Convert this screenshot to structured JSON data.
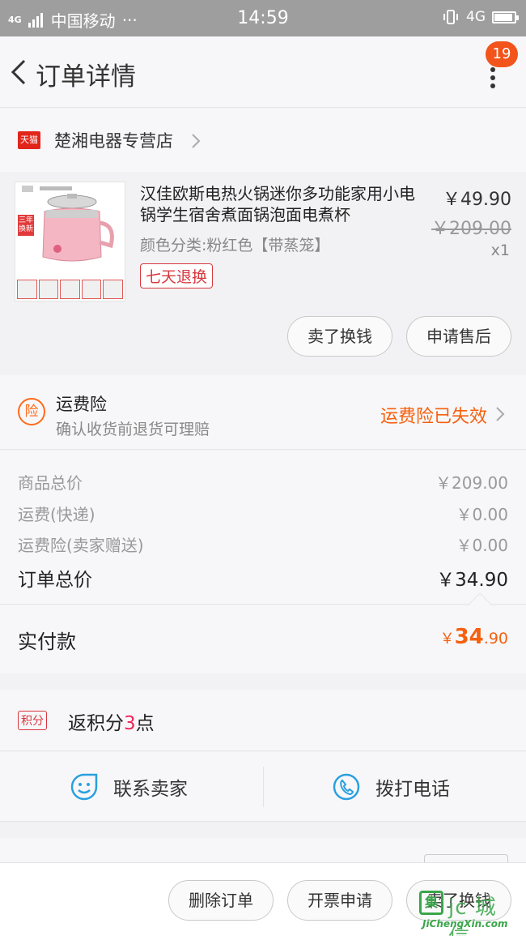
{
  "status_bar": {
    "network_tag": "4G",
    "carrier": "中国移动",
    "more": "···",
    "time": "14:59",
    "network_right": "4G",
    "battery_level": 0.9
  },
  "header": {
    "title": "订单详情",
    "badge_count": "19"
  },
  "store": {
    "tmall_tag": "天猫",
    "name": "楚湘电器专营店"
  },
  "product": {
    "title": "汉佳欧斯电热火锅迷你多功能家用小电锅学生宿舍煮面锅泡面电煮杯",
    "spec": "颜色分类:粉红色【带蒸笼】",
    "tag": "七天退换",
    "price": "￥49.90",
    "original_price": "￥209.00",
    "quantity": "x1",
    "image_tag": "三年换新",
    "actions": [
      "卖了换钱",
      "申请售后"
    ]
  },
  "insurance": {
    "icon_text": "险",
    "title": "运费险",
    "subtitle": "确认收货前退货可理赔",
    "status": "运费险已失效"
  },
  "summary": {
    "rows": [
      {
        "label": "商品总价",
        "value": "￥209.00"
      },
      {
        "label": "运费(快递)",
        "value": "￥0.00"
      },
      {
        "label": "运费险(卖家赠送)",
        "value": "￥0.00"
      }
    ],
    "total_label": "订单总价",
    "total_value": "￥34.90"
  },
  "paid": {
    "label": "实付款",
    "currency": "￥",
    "integer": "34",
    "decimal": ".90"
  },
  "points": {
    "icon_text": "积分",
    "prefix": "返积分",
    "number": "3",
    "suffix": "点"
  },
  "contact": {
    "seller": "联系卖家",
    "phone": "拨打电话"
  },
  "bottom_bar": {
    "buttons": [
      "删除订单",
      "开票申请",
      "卖了换钱"
    ]
  },
  "watermark": {
    "cn": "jc 城 信",
    "en": "JiChengXin.com",
    "mark": "集"
  },
  "colors": {
    "accent_orange": "#f5600e",
    "badge_orange": "#f2541b",
    "tmall_red": "#e1251b",
    "points_pink": "#f0245a",
    "contact_blue": "#2aa0e0"
  }
}
